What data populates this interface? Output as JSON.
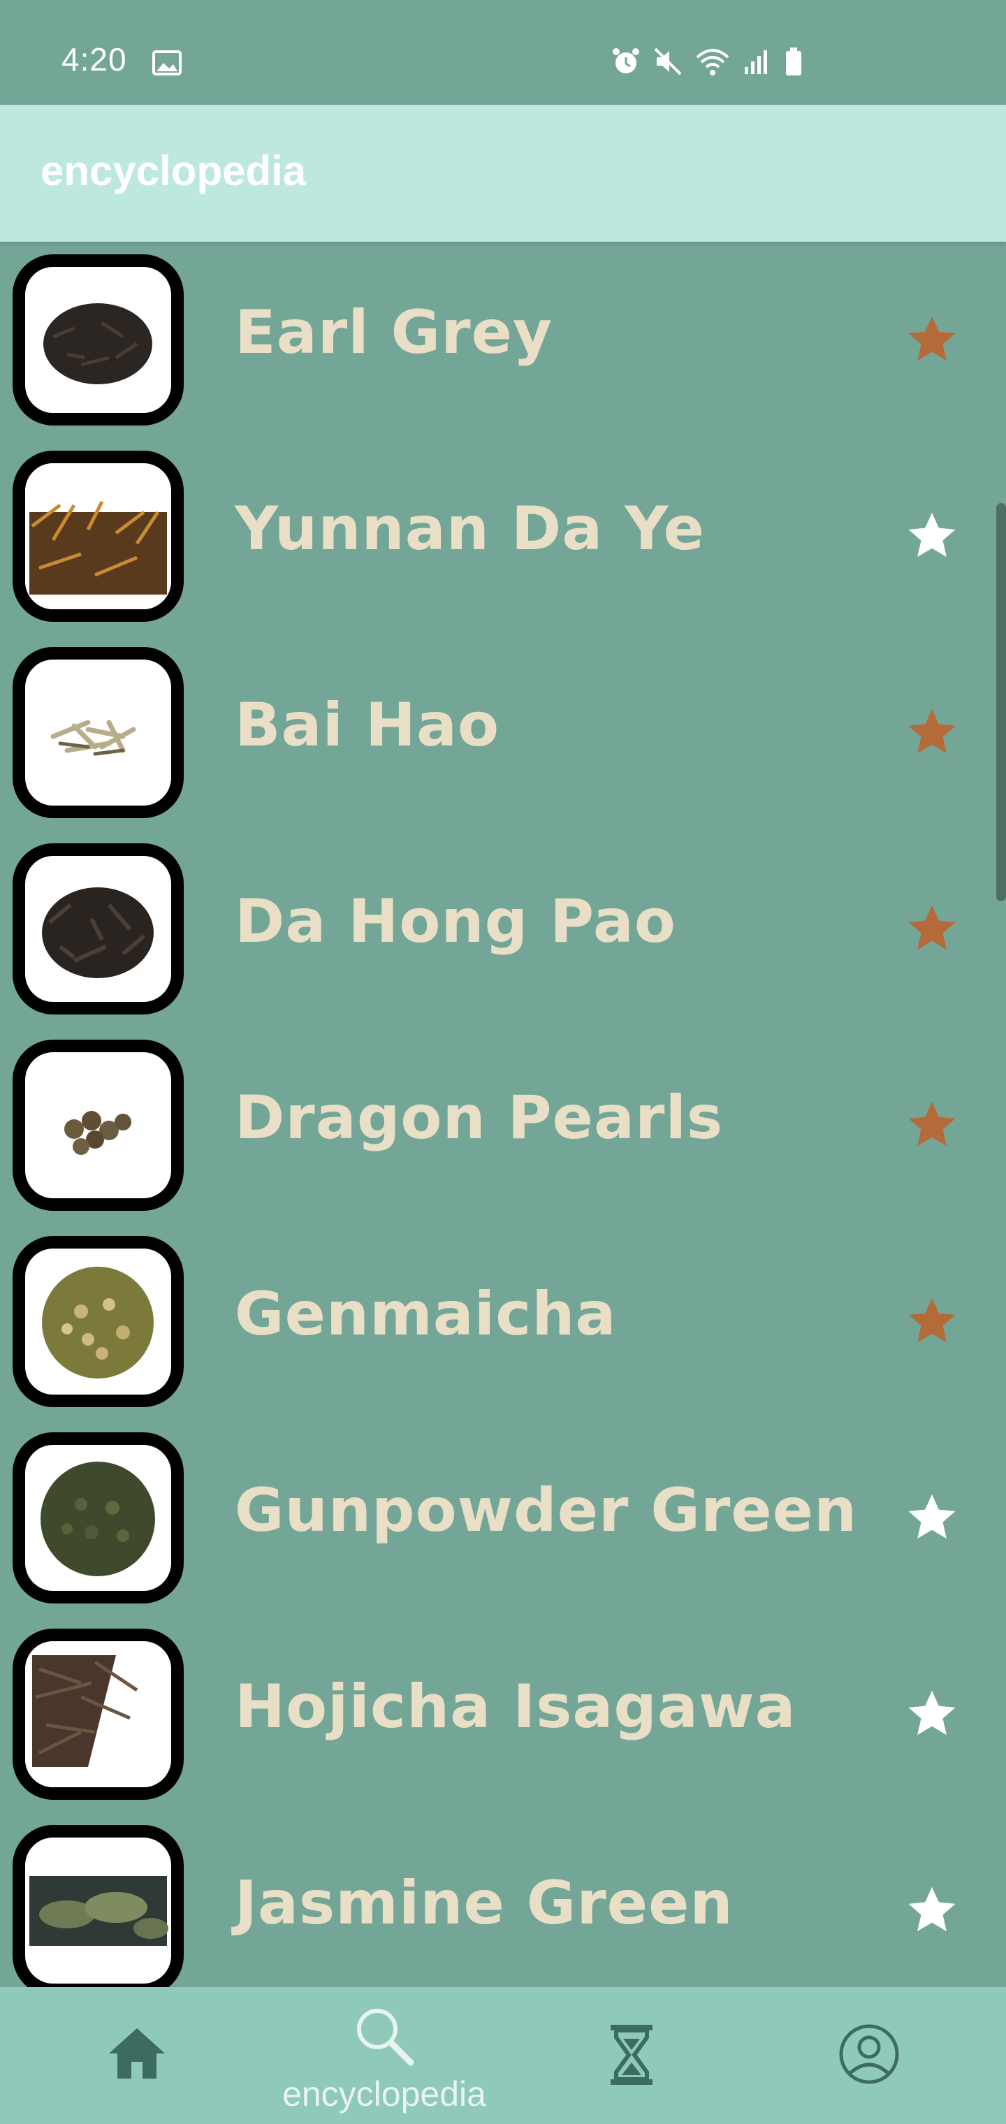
{
  "status_bar": {
    "time": "4:20",
    "icons": [
      "image-icon",
      "alarm-icon",
      "mute-icon",
      "wifi-icon",
      "signal-icon",
      "battery-icon"
    ]
  },
  "app_bar": {
    "title": "encyclopedia"
  },
  "teas": [
    {
      "name": "Earl Grey",
      "favorite": true
    },
    {
      "name": "Yunnan Da Ye",
      "favorite": false
    },
    {
      "name": "Bai Hao",
      "favorite": true
    },
    {
      "name": "Da Hong Pao",
      "favorite": true
    },
    {
      "name": "Dragon Pearls",
      "favorite": true
    },
    {
      "name": "Genmaicha",
      "favorite": true
    },
    {
      "name": "Gunpowder Green",
      "favorite": false
    },
    {
      "name": "Hojicha Isagawa",
      "favorite": false
    },
    {
      "name": "Jasmine Green",
      "favorite": false
    }
  ],
  "bottom_nav": {
    "items": [
      {
        "icon": "home-icon",
        "label": ""
      },
      {
        "icon": "search-icon",
        "label": "encyclopedia"
      },
      {
        "icon": "hourglass-icon",
        "label": ""
      },
      {
        "icon": "profile-icon",
        "label": ""
      }
    ],
    "active_index": 1
  },
  "colors": {
    "background": "#74a698",
    "app_bar": "#bde8df",
    "bottom_nav": "#8fc9b9",
    "tea_text": "#e9dfc6",
    "star_favorite": "#b56a3a",
    "star_default": "#ffffff",
    "nav_icon": "#3c6b60"
  }
}
